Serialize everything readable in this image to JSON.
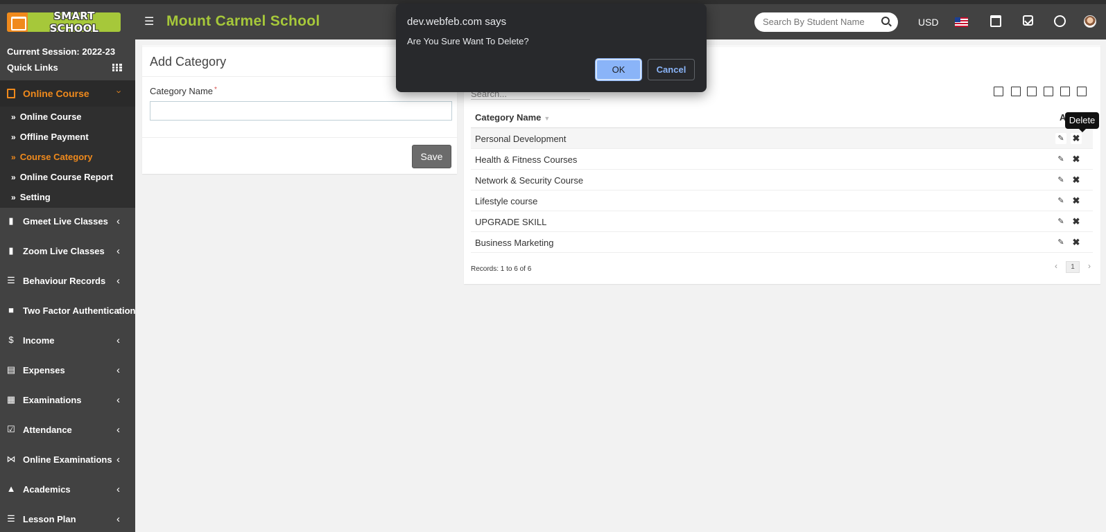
{
  "header": {
    "logo_text": "SMART SCHOOL",
    "school_name": "Mount Carmel School",
    "search_placeholder": "Search By Student Name",
    "currency": "USD"
  },
  "sidebar": {
    "session": "Current Session: 2022-23",
    "quick_links": "Quick Links",
    "active_menu": "Online Course",
    "submenu": [
      {
        "label": "Online Course"
      },
      {
        "label": "Offline Payment"
      },
      {
        "label": "Course Category"
      },
      {
        "label": "Online Course Report"
      },
      {
        "label": "Setting"
      }
    ],
    "items": [
      {
        "label": "Gmeet Live Classes",
        "icon": "video-icon"
      },
      {
        "label": "Zoom Live Classes",
        "icon": "video-icon"
      },
      {
        "label": "Behaviour Records",
        "icon": "signpost-icon"
      },
      {
        "label": "Two Factor Authentication",
        "icon": "lock-icon"
      },
      {
        "label": "Income",
        "icon": "dollar-icon"
      },
      {
        "label": "Expenses",
        "icon": "credit-card-icon"
      },
      {
        "label": "Examinations",
        "icon": "map-icon"
      },
      {
        "label": "Attendance",
        "icon": "calendar-check-icon"
      },
      {
        "label": "Online Examinations",
        "icon": "rss-icon"
      },
      {
        "label": "Academics",
        "icon": "graduation-cap-icon"
      },
      {
        "label": "Lesson Plan",
        "icon": "list-icon"
      }
    ]
  },
  "add_category": {
    "title": "Add Category",
    "field_label": "Category Name",
    "required_mark": "*",
    "field_value": "",
    "save_label": "Save"
  },
  "category_list": {
    "search_placeholder": "Search...",
    "columns": [
      "Category Name",
      "Action"
    ],
    "rows": [
      {
        "name": "Personal Development"
      },
      {
        "name": "Health & Fitness Courses"
      },
      {
        "name": "Network & Security Course"
      },
      {
        "name": "Lifestyle course"
      },
      {
        "name": "UPGRADE SKILL"
      },
      {
        "name": "Business Marketing"
      }
    ],
    "records": "Records: 1 to 6 of 6",
    "page": "1",
    "tooltip": "Delete"
  },
  "dialog": {
    "origin": "dev.webfeb.com says",
    "message": "Are You Sure Want To Delete?",
    "ok_label": "OK",
    "cancel_label": "Cancel"
  },
  "colors": {
    "accent_green": "#a6c83a",
    "accent_orange": "#f08a1c",
    "sidebar_bg": "#424242",
    "dialog_ok": "#8ab4f8"
  }
}
